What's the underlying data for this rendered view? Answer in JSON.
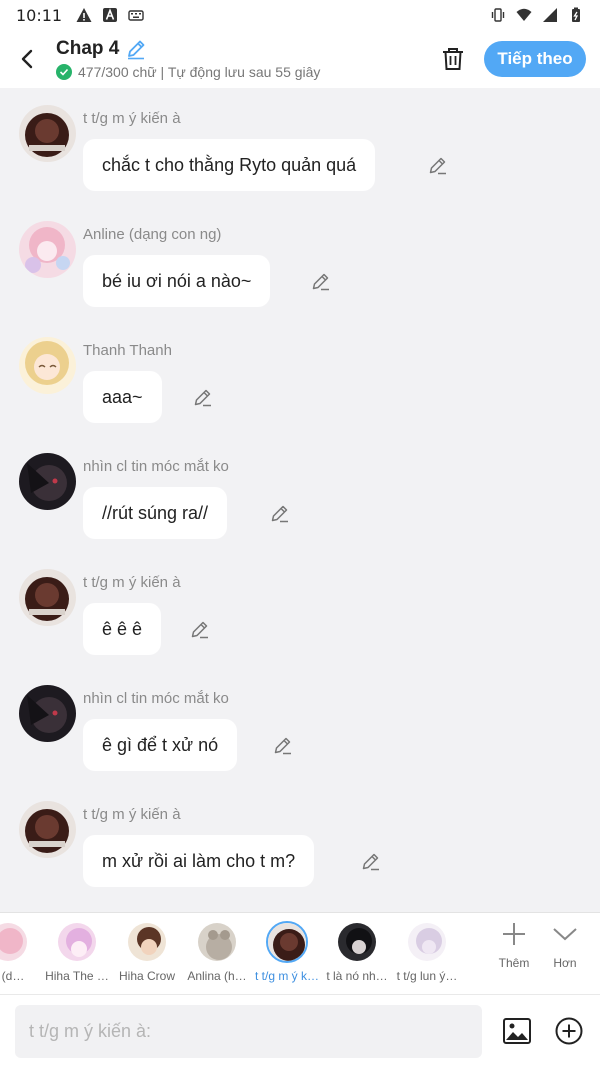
{
  "status_bar": {
    "time": "10:11"
  },
  "header": {
    "title": "Chap 4",
    "save_status": "477/300 chữ | Tự động lưu sau 55 giây",
    "next_label": "Tiếp theo"
  },
  "messages": [
    {
      "sender": "t t/g m ý kiến à",
      "text": "chắc t cho thằng Ryto quản quá"
    },
    {
      "sender": "Anline (dạng con ng)",
      "text": "bé iu ơi nói a nào~"
    },
    {
      "sender": "Thanh Thanh",
      "text": "aaa~"
    },
    {
      "sender": "nhìn cl tin móc mắt ko",
      "text": "//rút súng ra//"
    },
    {
      "sender": "t t/g m ý kiến à",
      "text": "ê ê ê"
    },
    {
      "sender": "nhìn cl tin móc mắt ko",
      "text": "ê gì để t xử nó"
    },
    {
      "sender": "t t/g m ý kiến à",
      "text": "m xử rồi ai làm cho t m?"
    }
  ],
  "characters": [
    {
      "name": "e (d…"
    },
    {
      "name": "Hiha The …"
    },
    {
      "name": "Hiha Crow"
    },
    {
      "name": "Anlina (h…"
    },
    {
      "name": "t t/g m ý k…"
    },
    {
      "name": "t là nó nh…"
    },
    {
      "name": "t t/g lun ý…"
    }
  ],
  "strip_actions": {
    "add_label": "Thêm",
    "more_label": "Hơn"
  },
  "input": {
    "placeholder": "t t/g m ý kiến à:",
    "value": ""
  },
  "colors": {
    "accent": "#52a8f5",
    "success": "#27b36a"
  }
}
